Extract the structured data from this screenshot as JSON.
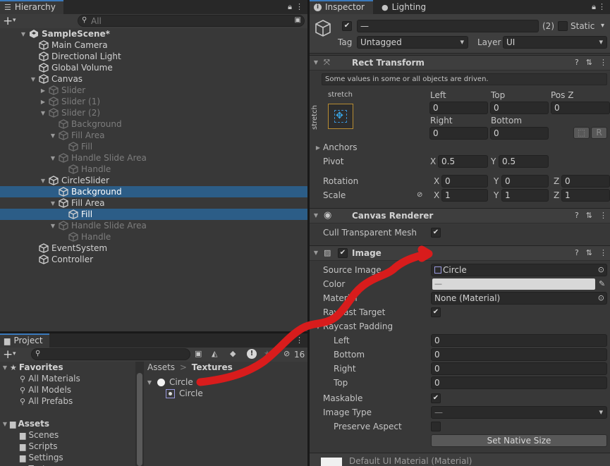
{
  "hierarchy": {
    "tab_label": "Hierarchy",
    "search_placeholder": "All",
    "add_label": "+",
    "rows": [
      {
        "label": "SampleScene*",
        "depth": 0,
        "twirl": "▼",
        "icon": "unity",
        "bold": true,
        "dim": false,
        "sel": false
      },
      {
        "label": "Main Camera",
        "depth": 1,
        "twirl": "",
        "icon": "cube",
        "dim": false,
        "sel": false
      },
      {
        "label": "Directional Light",
        "depth": 1,
        "twirl": "",
        "icon": "cube",
        "dim": false,
        "sel": false
      },
      {
        "label": "Global Volume",
        "depth": 1,
        "twirl": "",
        "icon": "cube",
        "dim": false,
        "sel": false
      },
      {
        "label": "Canvas",
        "depth": 1,
        "twirl": "▼",
        "icon": "cube",
        "dim": false,
        "sel": false
      },
      {
        "label": "Slider",
        "depth": 2,
        "twirl": "▶",
        "icon": "cube",
        "dim": true,
        "sel": false
      },
      {
        "label": "Slider (1)",
        "depth": 2,
        "twirl": "▶",
        "icon": "cube",
        "dim": true,
        "sel": false
      },
      {
        "label": "Slider (2)",
        "depth": 2,
        "twirl": "▼",
        "icon": "cube",
        "dim": true,
        "sel": false
      },
      {
        "label": "Background",
        "depth": 3,
        "twirl": "",
        "icon": "cube",
        "dim": true,
        "sel": false
      },
      {
        "label": "Fill Area",
        "depth": 3,
        "twirl": "▼",
        "icon": "cube",
        "dim": true,
        "sel": false
      },
      {
        "label": "Fill",
        "depth": 4,
        "twirl": "",
        "icon": "cube",
        "dim": true,
        "sel": false
      },
      {
        "label": "Handle Slide Area",
        "depth": 3,
        "twirl": "▼",
        "icon": "cube",
        "dim": true,
        "sel": false
      },
      {
        "label": "Handle",
        "depth": 4,
        "twirl": "",
        "icon": "cube",
        "dim": true,
        "sel": false
      },
      {
        "label": "CircleSlider",
        "depth": 2,
        "twirl": "▼",
        "icon": "cube",
        "dim": false,
        "sel": false
      },
      {
        "label": "Background",
        "depth": 3,
        "twirl": "",
        "icon": "cube",
        "dim": false,
        "sel": true
      },
      {
        "label": "Fill Area",
        "depth": 3,
        "twirl": "▼",
        "icon": "cube",
        "dim": false,
        "sel": false
      },
      {
        "label": "Fill",
        "depth": 4,
        "twirl": "",
        "icon": "cube",
        "dim": false,
        "sel": true
      },
      {
        "label": "Handle Slide Area",
        "depth": 3,
        "twirl": "▼",
        "icon": "cube",
        "dim": true,
        "sel": false
      },
      {
        "label": "Handle",
        "depth": 4,
        "twirl": "",
        "icon": "cube",
        "dim": true,
        "sel": false
      },
      {
        "label": "EventSystem",
        "depth": 1,
        "twirl": "",
        "icon": "cube",
        "dim": false,
        "sel": false
      },
      {
        "label": "Controller",
        "depth": 1,
        "twirl": "",
        "icon": "cube",
        "dim": false,
        "sel": false
      }
    ]
  },
  "project": {
    "tab_label": "Project",
    "hidden_count": "16",
    "favorites_label": "Favorites",
    "favorites": [
      "All Materials",
      "All Models",
      "All Prefabs"
    ],
    "assets_label": "Assets",
    "folders": [
      "Scenes",
      "Scripts",
      "Settings",
      "Textures"
    ],
    "breadcrumb": {
      "root": "Assets",
      "sep": ">",
      "current": "Textures"
    },
    "items": [
      {
        "label": "Circle",
        "icon": "circle"
      },
      {
        "label": "Circle",
        "icon": "sprite"
      }
    ]
  },
  "inspector": {
    "tab_label": "Inspector",
    "lighting_tab_label": "Lighting",
    "object_name": "—",
    "object_count": "(2)",
    "static_label": "Static",
    "tag_label": "Tag",
    "tag_value": "Untagged",
    "layer_label": "Layer",
    "layer_value": "UI",
    "rect": {
      "title": "Rect Transform",
      "notice": "Some values in some or all objects are driven.",
      "anchor_preset_top": "stretch",
      "anchor_preset_side": "stretch",
      "left_label": "Left",
      "top_label": "Top",
      "posz_label": "Pos Z",
      "left": "0",
      "top": "0",
      "posz": "0",
      "right_label": "Right",
      "bottom_label": "Bottom",
      "right": "0",
      "bottom": "0",
      "r_button": "R",
      "anchors_label": "Anchors",
      "pivot_label": "Pivot",
      "pivot_x": "0.5",
      "pivot_y": "0.5",
      "rotation_label": "Rotation",
      "rot_x": "0",
      "rot_y": "0",
      "rot_z": "0",
      "scale_label": "Scale",
      "scale_x": "1",
      "scale_y": "1",
      "scale_z": "1",
      "x": "X",
      "y": "Y",
      "z": "Z"
    },
    "canvas_renderer": {
      "title": "Canvas Renderer",
      "cull_label": "Cull Transparent Mesh"
    },
    "image": {
      "title": "Image",
      "source_label": "Source Image",
      "source_value": "Circle",
      "color_label": "Color",
      "color_value": "—",
      "material_label": "Material",
      "material_value": "None (Material)",
      "raycast_target_label": "Raycast Target",
      "raycast_padding_label": "Raycast Padding",
      "pad_left_label": "Left",
      "pad_bottom_label": "Bottom",
      "pad_right_label": "Right",
      "pad_top_label": "Top",
      "pad_left": "0",
      "pad_bottom": "0",
      "pad_right": "0",
      "pad_top": "0",
      "maskable_label": "Maskable",
      "image_type_label": "Image Type",
      "image_type_value": "—",
      "preserve_label": "Preserve Aspect",
      "native_size_button": "Set Native Size"
    },
    "footer_material": "Default UI Material (Material)"
  },
  "colors": {
    "selection": "#2c5d87",
    "annotation": "#d81c1c",
    "accent": "#3a79bb"
  }
}
